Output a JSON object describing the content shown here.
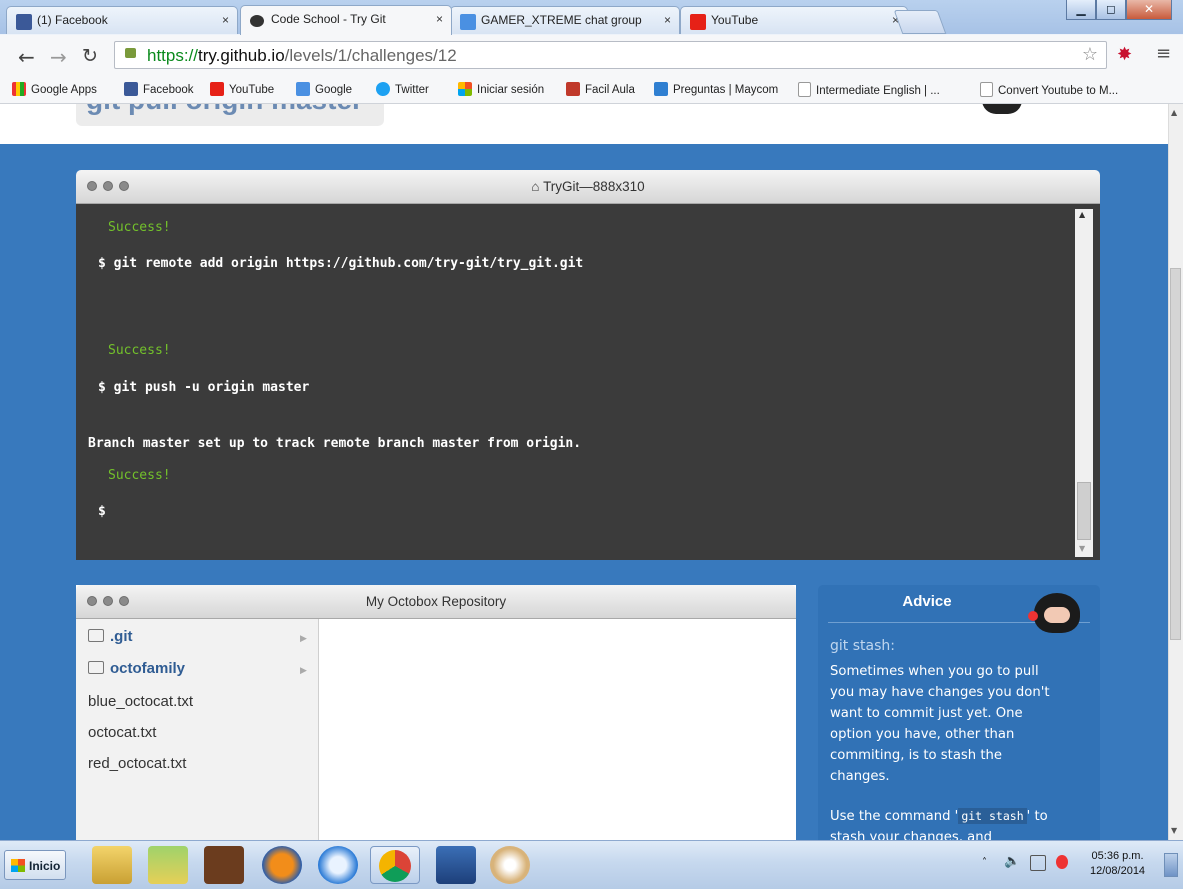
{
  "browser": {
    "tabs": [
      {
        "label": "(1) Facebook",
        "icon": "facebook-icon",
        "color": "#3b5998"
      },
      {
        "label": "Code School - Try Git",
        "icon": "code-school-icon",
        "color": "#333333"
      },
      {
        "label": "GAMER_XTREME chat group",
        "icon": "google-plus-icon",
        "color": "#4a90e2"
      },
      {
        "label": "YouTube",
        "icon": "youtube-icon",
        "color": "#e62117"
      }
    ],
    "tab_close": "×",
    "url": {
      "scheme": "https://",
      "host": "try.github.io",
      "path": "/levels/1/challenges/12"
    },
    "bookmarks": [
      {
        "label": "Google Apps",
        "icon": "apps-grid-icon"
      },
      {
        "label": "Facebook",
        "icon": "facebook-icon"
      },
      {
        "label": "YouTube",
        "icon": "youtube-icon"
      },
      {
        "label": "Google",
        "icon": "google-icon"
      },
      {
        "label": "Twitter",
        "icon": "twitter-bird-icon"
      },
      {
        "label": "Iniciar sesión",
        "icon": "microsoft-icon"
      },
      {
        "label": "Facil Aula",
        "icon": "facil-aula-icon"
      },
      {
        "label": "Preguntas | Maycom",
        "icon": "maycom-icon"
      },
      {
        "label": "Intermediate English | ...",
        "icon": "page-icon"
      },
      {
        "label": "Convert Youtube to M...",
        "icon": "page-icon"
      }
    ]
  },
  "page": {
    "command_banner": "git pull origin master",
    "terminal": {
      "title": "TryGit—888x310",
      "lines": [
        {
          "text": "Success!",
          "type": "ok"
        },
        {
          "text": "$ git remote add origin https://github.com/try-git/try_git.git",
          "type": "cmd"
        },
        {
          "text": "Success!",
          "type": "ok"
        },
        {
          "text": "$ git push -u origin master",
          "type": "cmd"
        },
        {
          "text": "Branch master set up to track remote branch master from origin.",
          "type": "out"
        },
        {
          "text": "Success!",
          "type": "ok"
        },
        {
          "text": "$",
          "type": "cmd"
        }
      ]
    },
    "repo": {
      "title": "My Octobox Repository",
      "items": [
        {
          "name": ".git",
          "kind": "dir"
        },
        {
          "name": "octofamily",
          "kind": "dir"
        },
        {
          "name": "blue_octocat.txt",
          "kind": "file"
        },
        {
          "name": "octocat.txt",
          "kind": "file"
        },
        {
          "name": "red_octocat.txt",
          "kind": "file"
        }
      ]
    },
    "advice": {
      "title": "Advice",
      "heading": "git stash:",
      "body": "Sometimes when you go to pull you may have changes you don't want to commit just yet. One option you have, other than commiting, is to stash the changes.",
      "body2_prefix": "Use the command '",
      "body2_code": "git stash",
      "body2_suffix": "' to stash your changes, and"
    }
  },
  "taskbar": {
    "start_label": "Inicio",
    "apps": [
      "explorer-icon",
      "windows-media-icon",
      "dosbox-icon",
      "firefox-icon",
      "itunes-icon",
      "chrome-icon",
      "word-icon",
      "paint-icon"
    ],
    "clock_time": "05:36 p.m.",
    "clock_date": "12/08/2014"
  },
  "colors": {
    "page_bg": "#3879bd",
    "terminal_bg": "#3b3b3b",
    "success": "#73c12b",
    "advice_bg": "#3172b6"
  }
}
